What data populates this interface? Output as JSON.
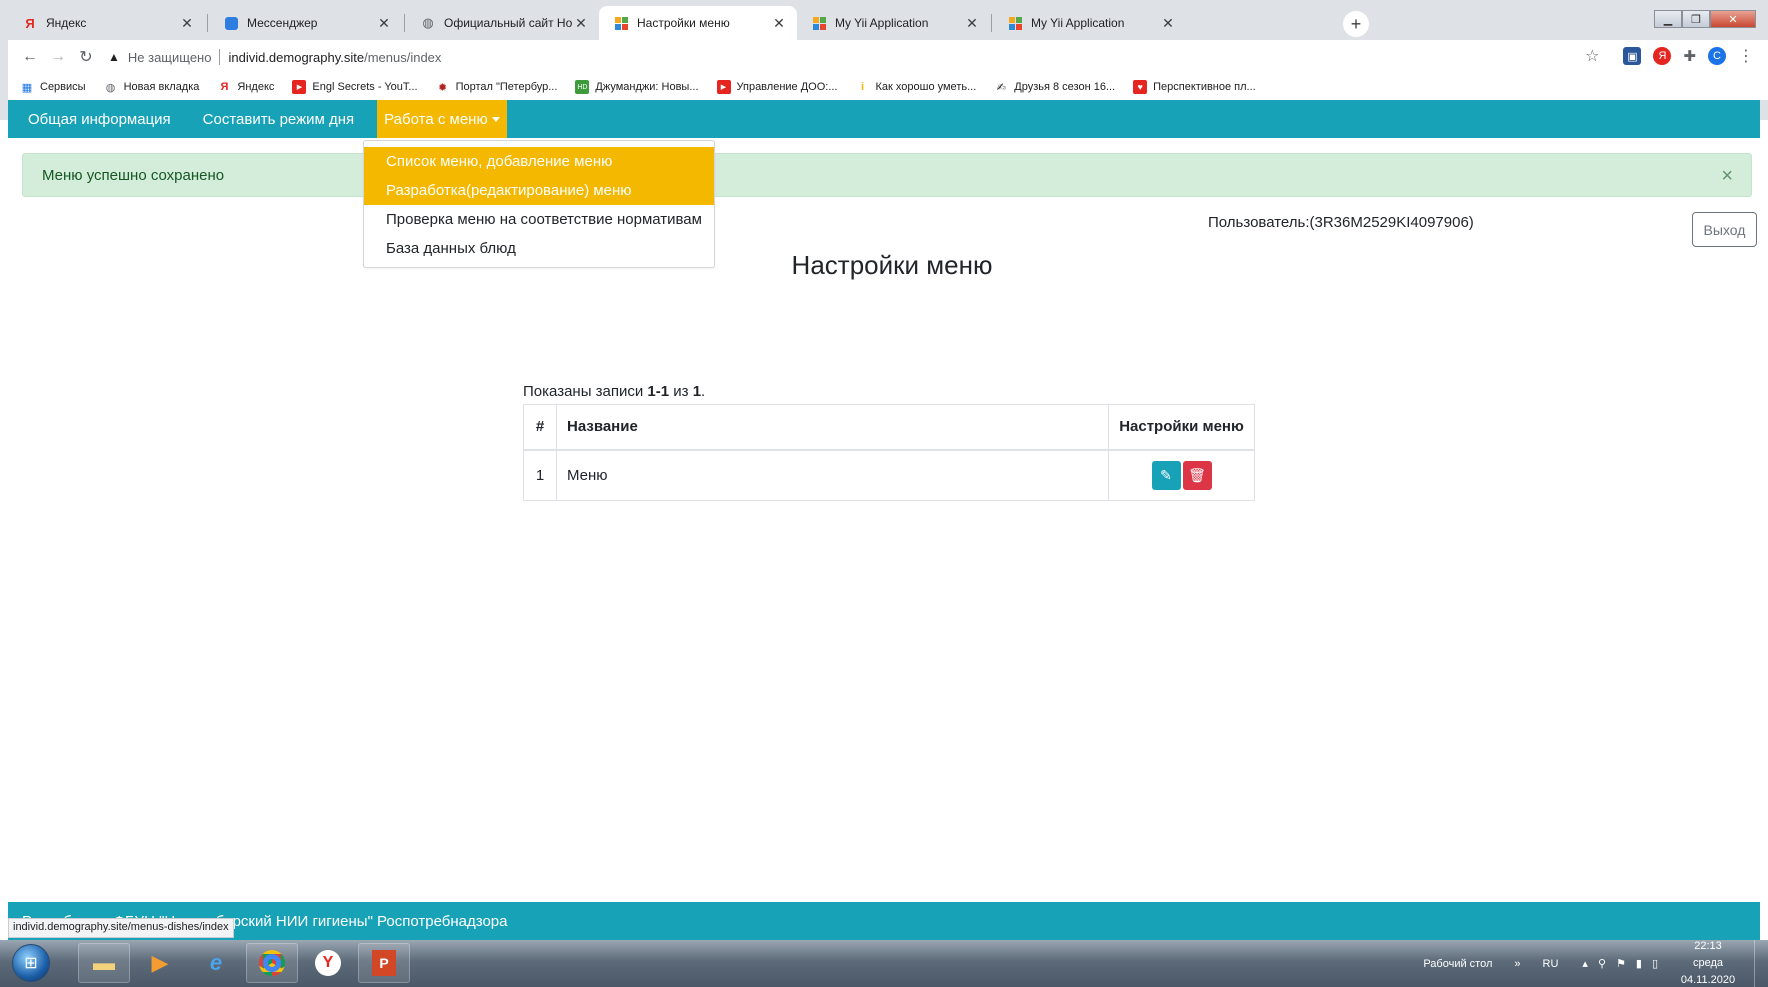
{
  "browser": {
    "tabs": [
      {
        "title": "Яндекс",
        "icon": "yandex-icon"
      },
      {
        "title": "Мессенджер",
        "icon": "messenger-icon"
      },
      {
        "title": "Официальный сайт Новосибир",
        "icon": "globe-icon"
      },
      {
        "title": "Настройки меню",
        "icon": "yii-icon",
        "active": true
      },
      {
        "title": "My Yii Application",
        "icon": "yii-icon"
      },
      {
        "title": "My Yii Application",
        "icon": "yii-icon"
      }
    ],
    "new_tab_glyph": "+",
    "address": {
      "security_label": "Не защищено",
      "url_host": "individ.demography.site",
      "url_path": "/menus/index"
    },
    "profile_initial": "C",
    "bookmarks": [
      {
        "label": "Сервисы",
        "icon": "apps-icon"
      },
      {
        "label": "Новая вкладка",
        "icon": "globe-icon"
      },
      {
        "label": "Яндекс",
        "icon": "yandex-icon"
      },
      {
        "label": "Engl Secrets - YouT...",
        "icon": "youtube-icon"
      },
      {
        "label": "Портал \"Петербур...",
        "icon": "crest-icon"
      },
      {
        "label": "Джуманджи: Новы...",
        "icon": "hd-icon"
      },
      {
        "label": "Управление ДОО:...",
        "icon": "youtube-icon"
      },
      {
        "label": "Как хорошо уметь...",
        "icon": "info-icon"
      },
      {
        "label": "Друзья 8 сезон 16...",
        "icon": "quill-icon"
      },
      {
        "label": "Перспективное пл...",
        "icon": "heart-icon"
      }
    ],
    "status_url": "individ.demography.site/menus-dishes/index"
  },
  "navbar": {
    "items": [
      "Общая информация",
      "Составить режим дня",
      "Работа с меню"
    ]
  },
  "dropdown": {
    "items": [
      "Список меню, добавление меню",
      "Разработка(редактирование) меню",
      "Проверка меню на соответствие нормативам",
      "База данных блюд"
    ]
  },
  "alert": {
    "message": "Меню успешно сохранено",
    "close": "×"
  },
  "user": {
    "label": "Пользователь:(3R36M2529KI4097906)",
    "logout": "Выход"
  },
  "page_title": "Настройки меню",
  "grid": {
    "summary_prefix": "Показаны записи ",
    "summary_range": "1-1",
    "summary_mid": " из ",
    "summary_total": "1",
    "summary_suffix": ".",
    "headers": [
      "#",
      "Название",
      "Настройки меню"
    ],
    "rows": [
      {
        "num": "1",
        "name": "Меню"
      }
    ]
  },
  "footer": {
    "text": "Разработчик ФБУН \"Новосибирский НИИ гигиены\" Роспотребнадзора"
  },
  "taskbar": {
    "desktop_label": "Рабочий стол",
    "language": "RU",
    "time": "22:13",
    "weekday": "среда",
    "date": "04.11.2020"
  },
  "colors": {
    "navbar": "#17a2b8",
    "menu_highlight": "#f5b800",
    "alert_bg": "#d4edda",
    "delete": "#dc3545"
  }
}
